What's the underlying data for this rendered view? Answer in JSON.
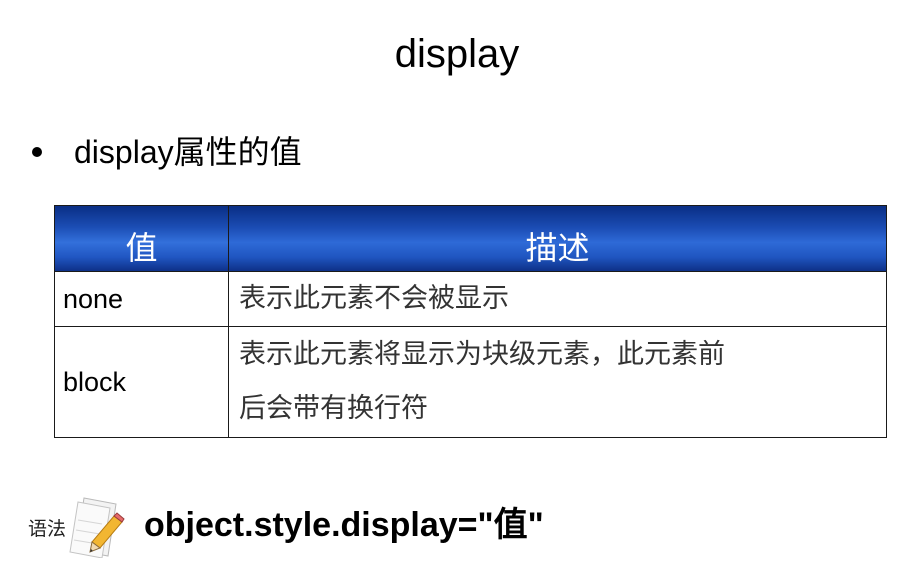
{
  "slide": {
    "title": "display",
    "bullet": "display属性的值"
  },
  "table": {
    "headers": [
      "值",
      "描述"
    ],
    "rows": [
      {
        "value": "none",
        "description": [
          "表示此元素不会被显示"
        ]
      },
      {
        "value": "block",
        "description": [
          "表示此元素将显示为块级元素，此元素前",
          "后会带有换行符"
        ]
      }
    ],
    "header_color": "#1f55c0"
  },
  "syntax": {
    "label": "语法",
    "icon": "pencil-document-icon",
    "code": "object.style.display=\"值\""
  }
}
